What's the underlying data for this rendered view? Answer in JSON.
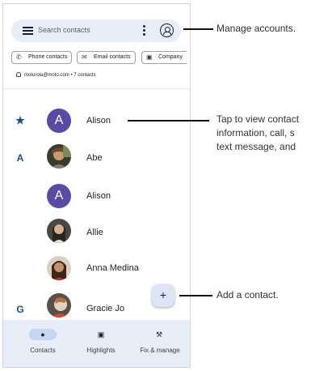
{
  "search": {
    "placeholder": "Search contacts"
  },
  "filters": [
    {
      "label": "Phone contacts",
      "icon": "phone-icon"
    },
    {
      "label": "Email contacts",
      "icon": "email-icon"
    },
    {
      "label": "Company",
      "icon": "company-icon"
    }
  ],
  "account_summary": "motorola@moto.com • 7 contacts",
  "contacts": [
    {
      "section": "★",
      "name": "Alison",
      "avatar_letter": "A",
      "avatar_color": "#5b4aa5"
    },
    {
      "section": "A",
      "name": "Abe"
    },
    {
      "section": "",
      "name": "Alison",
      "avatar_letter": "A",
      "avatar_color": "#5b4aa5"
    },
    {
      "section": "",
      "name": "Allie"
    },
    {
      "section": "",
      "name": "Anna Medina"
    },
    {
      "section": "G",
      "name": "Gracie Jo"
    }
  ],
  "fab": {
    "icon": "+"
  },
  "bottom_nav": [
    {
      "label": "Contacts",
      "icon": "person-icon",
      "active": true
    },
    {
      "label": "Highlights",
      "icon": "highlights-icon",
      "active": false
    },
    {
      "label": "Fix & manage",
      "icon": "wrench-icon",
      "active": false
    }
  ],
  "callouts": {
    "manage_accounts": "Manage accounts.",
    "tap_line1": "Tap to view contact",
    "tap_line2": "information, call, s",
    "tap_line3": "text message, and",
    "add_contact": "Add a contact."
  },
  "colors": {
    "accent": "#1a4e8c",
    "surface": "#e8eef8",
    "avatar": "#5b4aa5"
  }
}
